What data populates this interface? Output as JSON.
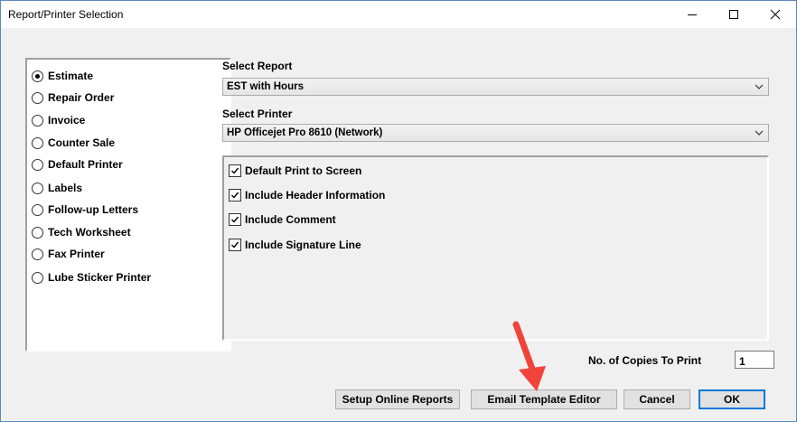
{
  "window": {
    "title": "Report/Printer Selection"
  },
  "report_types": [
    {
      "label": "Estimate",
      "checked": true
    },
    {
      "label": "Repair Order",
      "checked": false
    },
    {
      "label": "Invoice",
      "checked": false
    },
    {
      "label": "Counter Sale",
      "checked": false
    },
    {
      "label": "Default Printer",
      "checked": false
    },
    {
      "label": "Labels",
      "checked": false
    },
    {
      "label": "Follow-up Letters",
      "checked": false
    },
    {
      "label": "Tech Worksheet",
      "checked": false
    },
    {
      "label": "Fax Printer",
      "checked": false
    },
    {
      "label": "Lube Sticker Printer",
      "checked": false
    }
  ],
  "select_report": {
    "label": "Select Report",
    "value": "EST with Hours"
  },
  "select_printer": {
    "label": "Select Printer",
    "value": "HP Officejet Pro 8610 (Network)"
  },
  "options": [
    {
      "label": "Default Print to Screen",
      "checked": true
    },
    {
      "label": "Include Header Information",
      "checked": true
    },
    {
      "label": "Include Comment",
      "checked": true
    },
    {
      "label": "Include Signature Line",
      "checked": true
    }
  ],
  "copies": {
    "label": "No. of Copies To Print",
    "value": "1"
  },
  "buttons": {
    "setup_online": "Setup Online Reports",
    "email_template": "Email Template Editor",
    "cancel": "Cancel",
    "ok": "OK"
  },
  "colors": {
    "focus_border": "#0078d7",
    "annotation_arrow": "#f0433a"
  }
}
